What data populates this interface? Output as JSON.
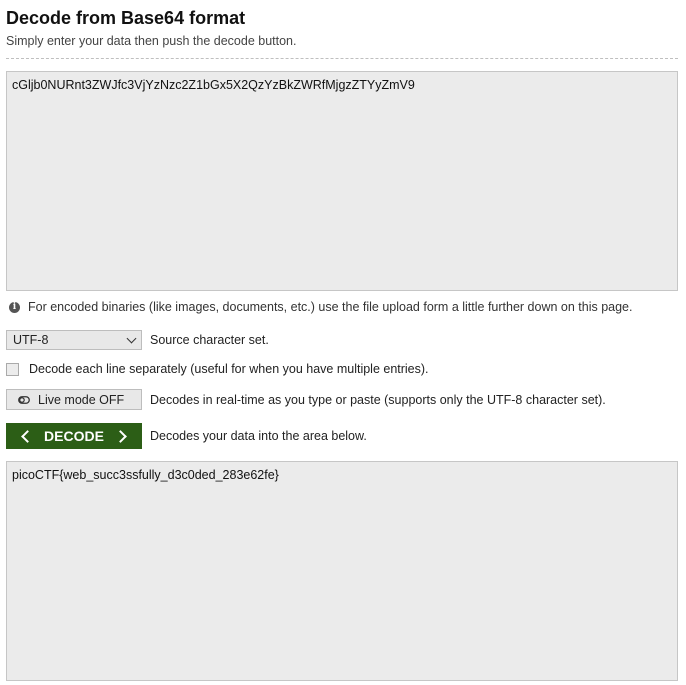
{
  "header": {
    "title": "Decode from Base64 format",
    "subtitle": "Simply enter your data then push the decode button."
  },
  "input": {
    "value": "cGljb0NURnt3ZWJfc3VjYzNzc2Z1bGx5X2QzYzBkZWRfMjgzZTYyZmV9"
  },
  "info": {
    "icon": "info-icon",
    "text": "For encoded binaries (like images, documents, etc.) use the file upload form a little further down on this page."
  },
  "charset": {
    "selected": "UTF-8",
    "label": "Source character set."
  },
  "options": {
    "separate_lines_label": "Decode each line separately (useful for when you have multiple entries).",
    "separate_lines_checked": false
  },
  "live_mode": {
    "button_label": "Live mode OFF",
    "description": "Decodes in real-time as you type or paste (supports only the UTF-8 character set)."
  },
  "decode": {
    "button_label": "DECODE",
    "description": "Decodes your data into the area below.",
    "button_color": "#2c5e16"
  },
  "output": {
    "value": "picoCTF{web_succ3ssfully_d3c0ded_283e62fe}"
  }
}
